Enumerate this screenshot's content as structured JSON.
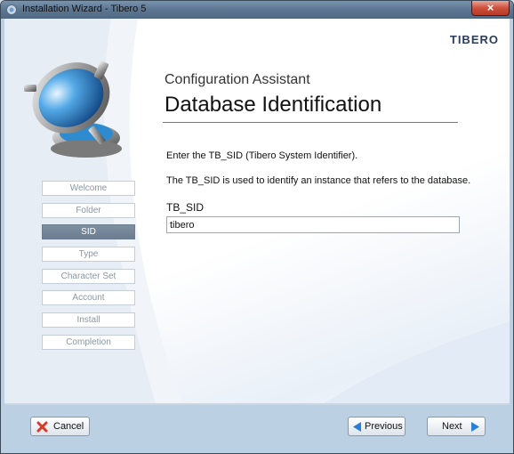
{
  "window": {
    "title": "Installation Wizard  - Tibero 5",
    "close_label": "×"
  },
  "brand": "TIBERO",
  "page": {
    "subtitle": "Configuration Assistant",
    "heading": "Database Identification",
    "description_1": "Enter the TB_SID (Tibero System Identifier).",
    "description_2": "The TB_SID is used to identify an instance that refers to the database.",
    "field_label": "TB_SID",
    "field_value": "tibero"
  },
  "steps": [
    {
      "label": "Welcome"
    },
    {
      "label": "Folder"
    },
    {
      "label": "SID",
      "active": true
    },
    {
      "label": "Type"
    },
    {
      "label": "Character Set"
    },
    {
      "label": "Account"
    },
    {
      "label": "Install"
    },
    {
      "label": "Completion"
    }
  ],
  "buttons": {
    "cancel": "Cancel",
    "previous": "Previous",
    "next": "Next"
  },
  "colors": {
    "active_step": "#6b7d8f",
    "brand": "#2b3d5c",
    "cancel_icon": "#d63a2a",
    "arrow_icon": "#2a7fd6"
  }
}
